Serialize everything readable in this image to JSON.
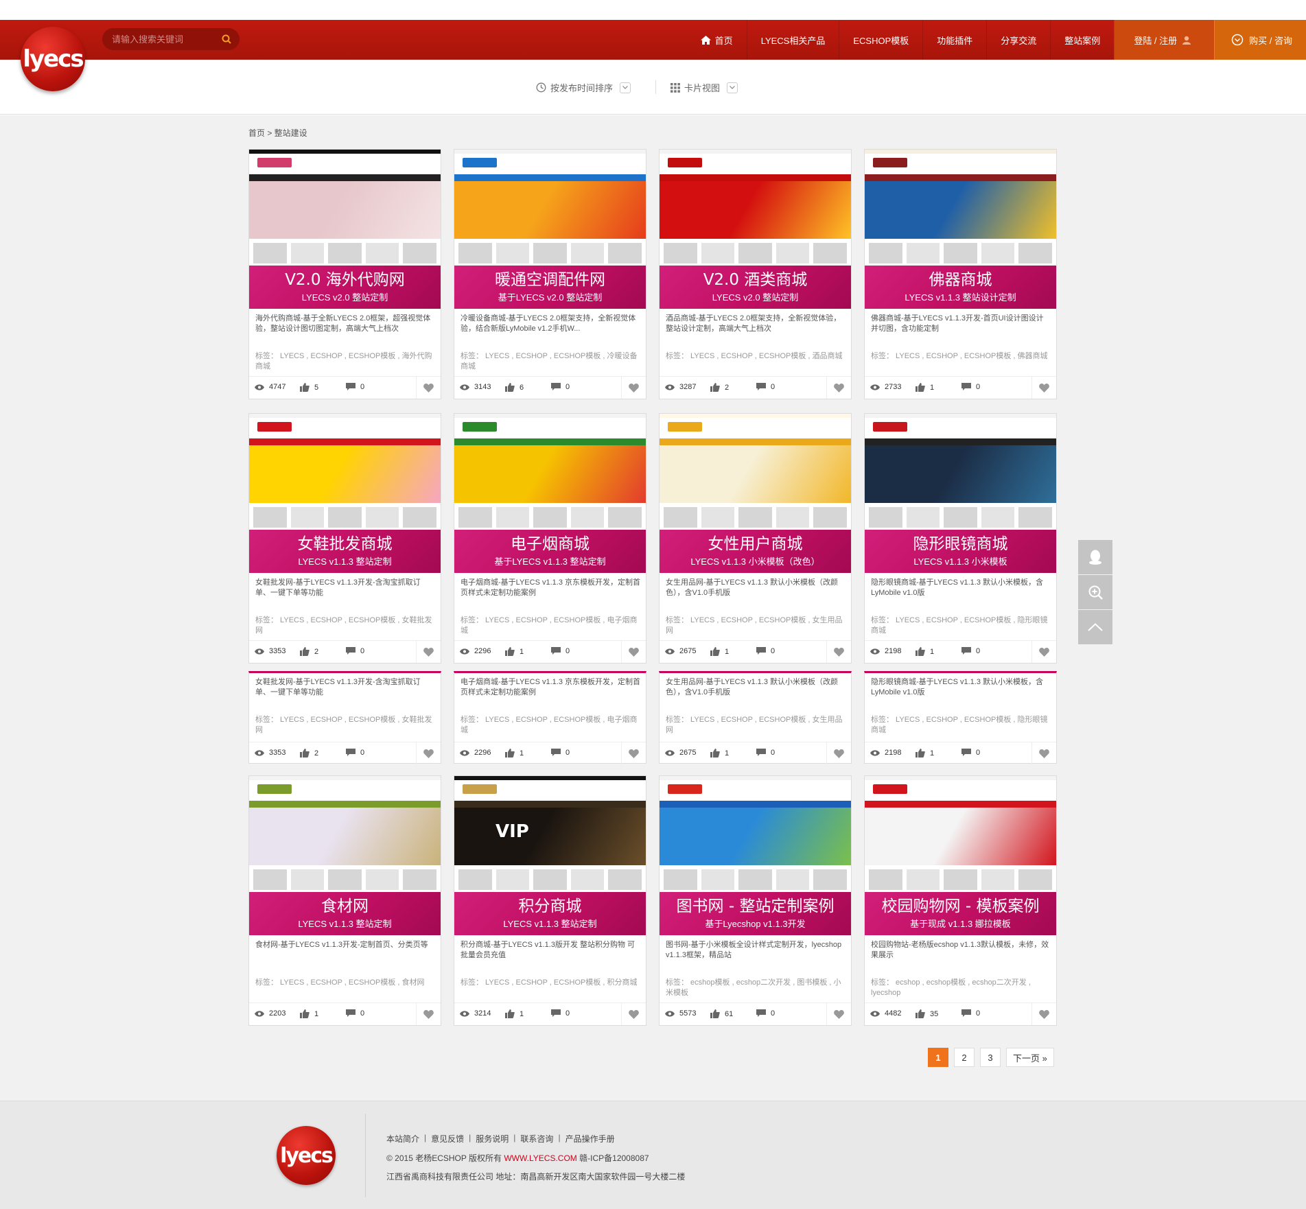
{
  "header": {
    "logo_text": "lyecs",
    "search_placeholder": "请输入搜索关键词",
    "nav": [
      {
        "label": "首页",
        "icon": "home-icon"
      },
      {
        "label": "LYECS相关产品"
      },
      {
        "label": "ECSHOP模板"
      },
      {
        "label": "功能插件"
      },
      {
        "label": "分享交流"
      },
      {
        "label": "整站案例"
      },
      {
        "label": "登陆 / 注册",
        "icon": "user-icon"
      },
      {
        "label": "购买 / 咨询",
        "icon": "chevron-circle-icon"
      }
    ]
  },
  "sortbar": {
    "sort_label": "按发布时间排序",
    "view_label": "卡片视图"
  },
  "breadcrumb": "首页 > 整站建设",
  "cards": [
    {
      "title": "V2.0 海外代购网",
      "subtitle": "LYECS v2.0 整站定制",
      "desc": "海外代购商城-基于全新LYECS 2.0框架，超强视觉体验，整站设计图切图定制，高端大气上档次",
      "tags": "标签： LYECS , ECSHOP , ECSHOP模板 , 海外代购商城",
      "views": "4747",
      "likes": "5",
      "comments": "0",
      "theme": {
        "bar": "#111111",
        "nav": "#222222",
        "banner": "#e7c7cb",
        "banner2": "#f4e3e4",
        "logo": "#d23c6a",
        "text": ""
      }
    },
    {
      "title": "暖通空调配件网",
      "subtitle": "基于LYECS v2.0 整站定制",
      "desc": "冷暖设备商城-基于LYECS 2.0框架支持，全新视觉体验，结合新版LyMobile v1.2手机W...",
      "tags": "标签： LYECS , ECSHOP , ECSHOP模板 , 冷暖设备商城",
      "views": "3143",
      "likes": "6",
      "comments": "0",
      "theme": {
        "bar": "#f3f3f3",
        "nav": "#1d73c9",
        "banner": "#f6a51b",
        "banner2": "#e53c1c",
        "logo": "#1d73c9",
        "text": ""
      }
    },
    {
      "title": "V2.0 酒类商城",
      "subtitle": "LYECS v2.0 整站定制",
      "desc": "酒品商城-基于LYECS 2.0框架支持，全新视觉体验，整站设计定制，高端大气上档次",
      "tags": "标签： LYECS , ECSHOP , ECSHOP模板 , 酒品商城",
      "views": "3287",
      "likes": "2",
      "comments": "0",
      "theme": {
        "bar": "#f3f3f3",
        "nav": "#c30d0d",
        "banner": "#d40f0f",
        "banner2": "#ffc326",
        "logo": "#c30d0d",
        "text": ""
      }
    },
    {
      "title": "佛器商城",
      "subtitle": "LYECS v1.1.3 整站设计定制",
      "desc": "佛器商城-基于LYECS v1.1.3开发-首页UI设计图设计并切图，含功能定制",
      "tags": "标签： LYECS , ECSHOP , ECSHOP模板 , 佛器商城",
      "views": "2733",
      "likes": "1",
      "comments": "0",
      "theme": {
        "bar": "#f5efe0",
        "nav": "#8a1e1e",
        "banner": "#1f5fa8",
        "banner2": "#f0c02a",
        "logo": "#8a1e1e",
        "text": ""
      }
    },
    {
      "title": "女鞋批发商城",
      "subtitle": "LYECS v1.1.3 整站定制",
      "desc": "女鞋批发网-基于LYECS v1.1.3开发-含淘宝抓取订单、一键下单等功能",
      "tags": "标签： LYECS , ECSHOP , ECSHOP模板 , 女鞋批发网",
      "views": "3353",
      "likes": "2",
      "comments": "0",
      "theme": {
        "bar": "#f3f3f3",
        "nav": "#d2151d",
        "banner": "#ffd400",
        "banner2": "#f6a6c1",
        "logo": "#d2151d",
        "text": ""
      }
    },
    {
      "title": "电子烟商城",
      "subtitle": "基于LYECS v1.1.3 整站定制",
      "desc": "电子烟商城-基于LYECS v1.1.3 京东模板开发，定制首页样式未定制功能案例",
      "tags": "标签： LYECS , ECSHOP , ECSHOP模板 , 电子烟商城",
      "views": "2296",
      "likes": "1",
      "comments": "0",
      "theme": {
        "bar": "#f3f3f3",
        "nav": "#2b8a2b",
        "banner": "#f6c300",
        "banner2": "#e23b2e",
        "logo": "#2b8a2b",
        "text": ""
      }
    },
    {
      "title": "女性用户商城",
      "subtitle": "LYECS v1.1.3 小米模板（改色）",
      "desc": "女生用品网-基于LYECS v1.1.3 默认小米模板（改颜色），含V1.0手机版",
      "tags": "标签： LYECS , ECSHOP , ECSHOP模板 , 女生用品网",
      "views": "2675",
      "likes": "1",
      "comments": "0",
      "theme": {
        "bar": "#fff8e6",
        "nav": "#e9a91a",
        "banner": "#f7f0d6",
        "banner2": "#f2b72a",
        "logo": "#e9a91a",
        "text": ""
      }
    },
    {
      "title": "隐形眼镜商城",
      "subtitle": "LYECS v1.1.3 小米模板",
      "desc": "隐形眼镜商城-基于LYECS v1.1.3 默认小米模板，含LyMobile v1.0版",
      "tags": "标签： LYECS , ECSHOP , ECSHOP模板 , 隐形眼镜商城",
      "views": "2198",
      "likes": "1",
      "comments": "0",
      "theme": {
        "bar": "#f3f3f3",
        "nav": "#222222",
        "banner": "#1b2c45",
        "banner2": "#2f6f9a",
        "logo": "#c8161d",
        "text": ""
      }
    }
  ],
  "cards_short": [
    {
      "desc": "女鞋批发网-基于LYECS v1.1.3开发-含淘宝抓取订单、一键下单等功能",
      "tags": "标签： LYECS , ECSHOP , ECSHOP模板 , 女鞋批发网",
      "views": "3353",
      "likes": "2",
      "comments": "0"
    },
    {
      "desc": "电子烟商城-基于LYECS v1.1.3 京东模板开发，定制首页样式未定制功能案例",
      "tags": "标签： LYECS , ECSHOP , ECSHOP模板 , 电子烟商城",
      "views": "2296",
      "likes": "1",
      "comments": "0"
    },
    {
      "desc": "女生用品网-基于LYECS v1.1.3 默认小米模板（改颜色），含V1.0手机版",
      "tags": "标签： LYECS , ECSHOP , ECSHOP模板 , 女生用品网",
      "views": "2675",
      "likes": "1",
      "comments": "0"
    },
    {
      "desc": "隐形眼镜商城-基于LYECS v1.1.3 默认小米模板，含LyMobile v1.0版",
      "tags": "标签： LYECS , ECSHOP , ECSHOP模板 , 隐形眼镜商城",
      "views": "2198",
      "likes": "1",
      "comments": "0"
    }
  ],
  "cards_row3": [
    {
      "title": "食材网",
      "subtitle": "LYECS v1.1.3 整站定制",
      "desc": "食材网-基于LYECS v1.1.3开发-定制首页、分类页等",
      "tags": "标签： LYECS , ECSHOP , ECSHOP模板 , 食材网",
      "views": "2203",
      "likes": "1",
      "comments": "0",
      "theme": {
        "bar": "#f3f3f3",
        "nav": "#7b9b2a",
        "banner": "#e9e2ef",
        "banner2": "#c9b27a",
        "logo": "#7b9b2a",
        "text": ""
      }
    },
    {
      "title": "积分商城",
      "subtitle": "LYECS v1.1.3 整站定制",
      "desc": "积分商城-基于LYECS v1.1.3版开发 整站积分购物 可批量会员充值",
      "tags": "标签： LYECS , ECSHOP , ECSHOP模板 , 积分商城",
      "views": "3214",
      "likes": "1",
      "comments": "0",
      "theme": {
        "bar": "#111111",
        "nav": "#3a2c1a",
        "banner": "#1a1410",
        "banner2": "#6b4f2a",
        "logo": "#c9a04a",
        "text": "VIP"
      }
    },
    {
      "title": "图书网 - 整站定制案例",
      "subtitle": "基于Lyecshop v1.1.3开发",
      "desc": "图书网-基于小米模板全设计样式定制开发，lyecshop v1.1.3框架，精品站",
      "tags": "标签： ecshop模板 , ecshop二次开发 , 图书模板 , 小米模板",
      "views": "5573",
      "likes": "61",
      "comments": "0",
      "theme": {
        "bar": "#f3f3f3",
        "nav": "#1c5fb8",
        "banner": "#2a8ad8",
        "banner2": "#7cc04a",
        "logo": "#d8261d",
        "text": ""
      }
    },
    {
      "title": "校园购物网 - 模板案例",
      "subtitle": "基于现成 v1.1.3 娜拉模板",
      "desc": "校园购物站-老杨版ecshop v1.1.3默认模板，未修，效果展示",
      "tags": "标签： ecshop , ecshop模板 , ecshop二次开发 , lyecshop",
      "views": "4482",
      "likes": "35",
      "comments": "0",
      "theme": {
        "bar": "#f3f3f3",
        "nav": "#d2151d",
        "banner": "#f4f4f4",
        "banner2": "#d2151d",
        "logo": "#d2151d",
        "text": ""
      }
    }
  ],
  "pagination": [
    "1",
    "2",
    "3",
    "下一页 »"
  ],
  "footer": {
    "logo_text": "lyecs",
    "links": [
      "本站简介",
      "意见反馈",
      "服务说明",
      "联系咨询",
      "产品操作手册"
    ],
    "copyright_prefix": "© 2015 老杨ECSHOP 版权所有",
    "copyright_domain": "WWW.LYECS.COM",
    "icp": "赣-ICP备12008087",
    "address": "江西省禹商科技有限责任公司 地址：南昌高新开发区南大国家软件园一号大楼二楼"
  },
  "colors": {
    "brand_red": "#b8150b",
    "ribbon_magenta": "#c6005c",
    "accent_orange": "#f0731b",
    "login_bg": "#cc4a0e",
    "buy_bg": "#d5660c"
  }
}
